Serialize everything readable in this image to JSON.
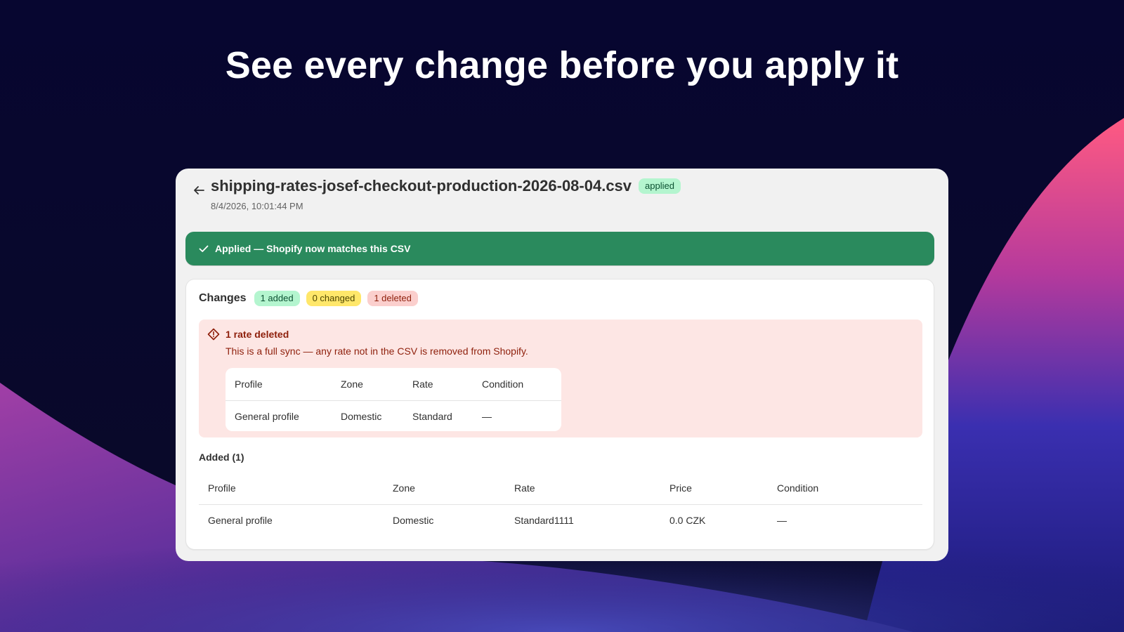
{
  "headline": "See every change before you apply it",
  "page": {
    "back_icon": "arrow-left-icon",
    "title": "shipping-rates-josef-checkout-production-2026-08-04.csv",
    "status_badge": "applied",
    "timestamp": "8/4/2026, 10:01:44 PM"
  },
  "banner": {
    "icon": "checkmark-icon",
    "text": "Applied — Shopify now matches this CSV"
  },
  "changes": {
    "title": "Changes",
    "added_badge": "1 added",
    "changed_badge": "0 changed",
    "deleted_badge": "1 deleted"
  },
  "deleted_section": {
    "icon": "alert-diamond-icon",
    "title": "1 rate deleted",
    "description": "This is a full sync — any rate not in the CSV is removed from Shopify.",
    "columns": [
      "Profile",
      "Zone",
      "Rate",
      "Condition"
    ],
    "rows": [
      [
        "General profile",
        "Domestic",
        "Standard",
        "—"
      ]
    ]
  },
  "added_section": {
    "title": "Added (1)",
    "columns": [
      "Profile",
      "Zone",
      "Rate",
      "Price",
      "Condition"
    ],
    "rows": [
      [
        "General profile",
        "Domestic",
        "Standard1111",
        "0.0 CZK",
        "—"
      ]
    ]
  },
  "colors": {
    "background": "#06052a",
    "success": "#2a8a5d",
    "critical_bg": "#fde6e4",
    "critical_text": "#8e1f0b",
    "badge_green": "#b4f5cf",
    "badge_yellow": "#ffe76a",
    "badge_red": "#fbcfcd"
  }
}
